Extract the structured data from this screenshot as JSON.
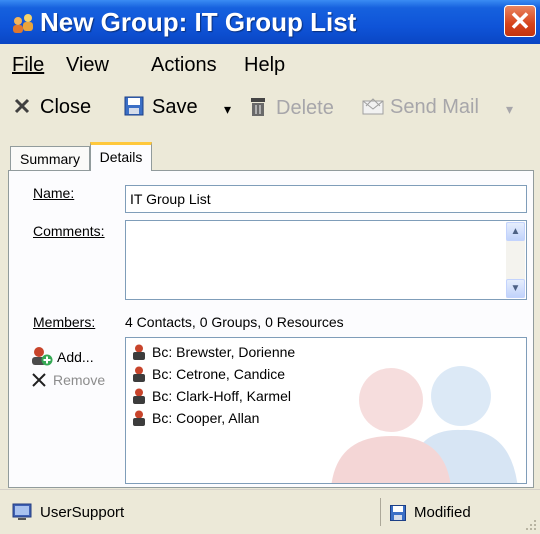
{
  "window": {
    "title": "New Group: IT Group List",
    "close_glyph": "✕"
  },
  "menu": [
    {
      "label": "File"
    },
    {
      "label": "View"
    },
    {
      "label": "Actions"
    },
    {
      "label": "Help"
    }
  ],
  "toolbar": {
    "close_label": "Close",
    "save_label": "Save",
    "delete_label": "Delete",
    "send_mail_label": "Send Mail",
    "dropdown_glyph": "▾"
  },
  "tabs": [
    {
      "label": "Summary",
      "active": false
    },
    {
      "label": "Details",
      "active": true
    }
  ],
  "form": {
    "name_label": "Name:",
    "name_value": "IT Group List",
    "comments_label": "Comments:",
    "comments_value": "",
    "members_label": "Members:",
    "members_summary": "4 Contacts, 0 Groups, 0 Resources",
    "add_label": "Add...",
    "remove_label": "Remove"
  },
  "members": [
    {
      "label": "Bc: Brewster, Dorienne"
    },
    {
      "label": "Bc: Cetrone, Candice"
    },
    {
      "label": "Bc: Clark-Hoff, Karmel"
    },
    {
      "label": "Bc: Cooper, Allan"
    }
  ],
  "status": {
    "left": "UserSupport",
    "right": "Modified"
  },
  "colors": {
    "titlebar": "#0f54d8",
    "chrome": "#ece9d8",
    "active_tab_accent": "#ffc83c",
    "close_button": "#d6431a"
  }
}
